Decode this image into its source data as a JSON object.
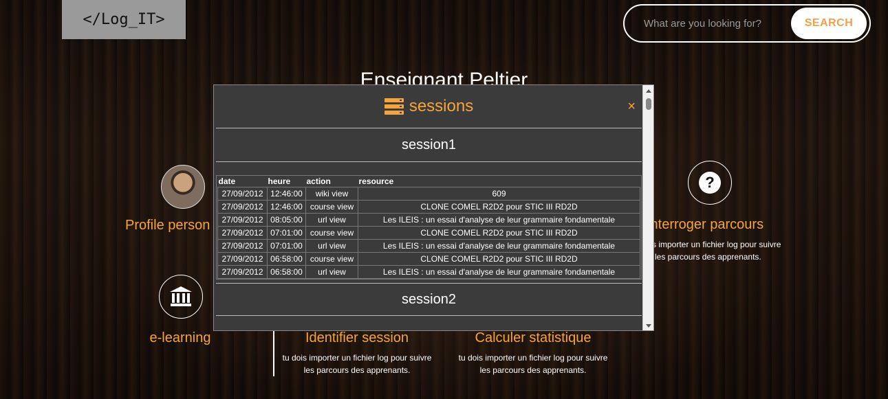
{
  "header": {
    "logo_text": "</Log_IT>",
    "search_placeholder": "What are you looking for?",
    "search_button": "SEARCH"
  },
  "page_title": "Enseignant Peltier",
  "tiles": {
    "profile": {
      "title": "Profile person"
    },
    "interroger": {
      "title": "Interroger parcours",
      "desc_line1": "s importer un fichier log pour suivre",
      "desc_line2": "les parcours des apprenants."
    },
    "elearning": {
      "title": "e-learning"
    },
    "identifier": {
      "title": "Identifier session",
      "desc_line1": "tu dois importer un fichier log pour suivre",
      "desc_line2": "les parcours des apprenants."
    },
    "calculer": {
      "title": "Calculer statistique",
      "desc_line1": "tu dois importer un fichier log pour suivre",
      "desc_line2": "les parcours des apprenants."
    }
  },
  "modal": {
    "title": "sessions",
    "close": "×",
    "sessions": [
      {
        "name": "session1",
        "columns": [
          "date",
          "heure",
          "action",
          "resource"
        ],
        "rows": [
          [
            "27/09/2012",
            "12:46:00",
            "wiki view",
            "609"
          ],
          [
            "27/09/2012",
            "12:46:00",
            "course view",
            "CLONE COMEL R2D2 pour STIC III RD2D"
          ],
          [
            "27/09/2012",
            "08:05:00",
            "url view",
            "Les ILEIS : un essai d'analyse de leur grammaire fondamentale"
          ],
          [
            "27/09/2012",
            "07:01:00",
            "course view",
            "CLONE COMEL R2D2 pour STIC III RD2D"
          ],
          [
            "27/09/2012",
            "07:01:00",
            "url view",
            "Les ILEIS : un essai d'analyse de leur grammaire fondamentale"
          ],
          [
            "27/09/2012",
            "06:58:00",
            "course view",
            "CLONE COMEL R2D2 pour STIC III RD2D"
          ],
          [
            "27/09/2012",
            "06:58:00",
            "url view",
            "Les ILEIS : un essai d'analyse de leur grammaire fondamentale"
          ]
        ]
      },
      {
        "name": "session2"
      }
    ]
  },
  "colors": {
    "accent": "#f5a53b",
    "modal_bg": "#3b3b3b"
  }
}
